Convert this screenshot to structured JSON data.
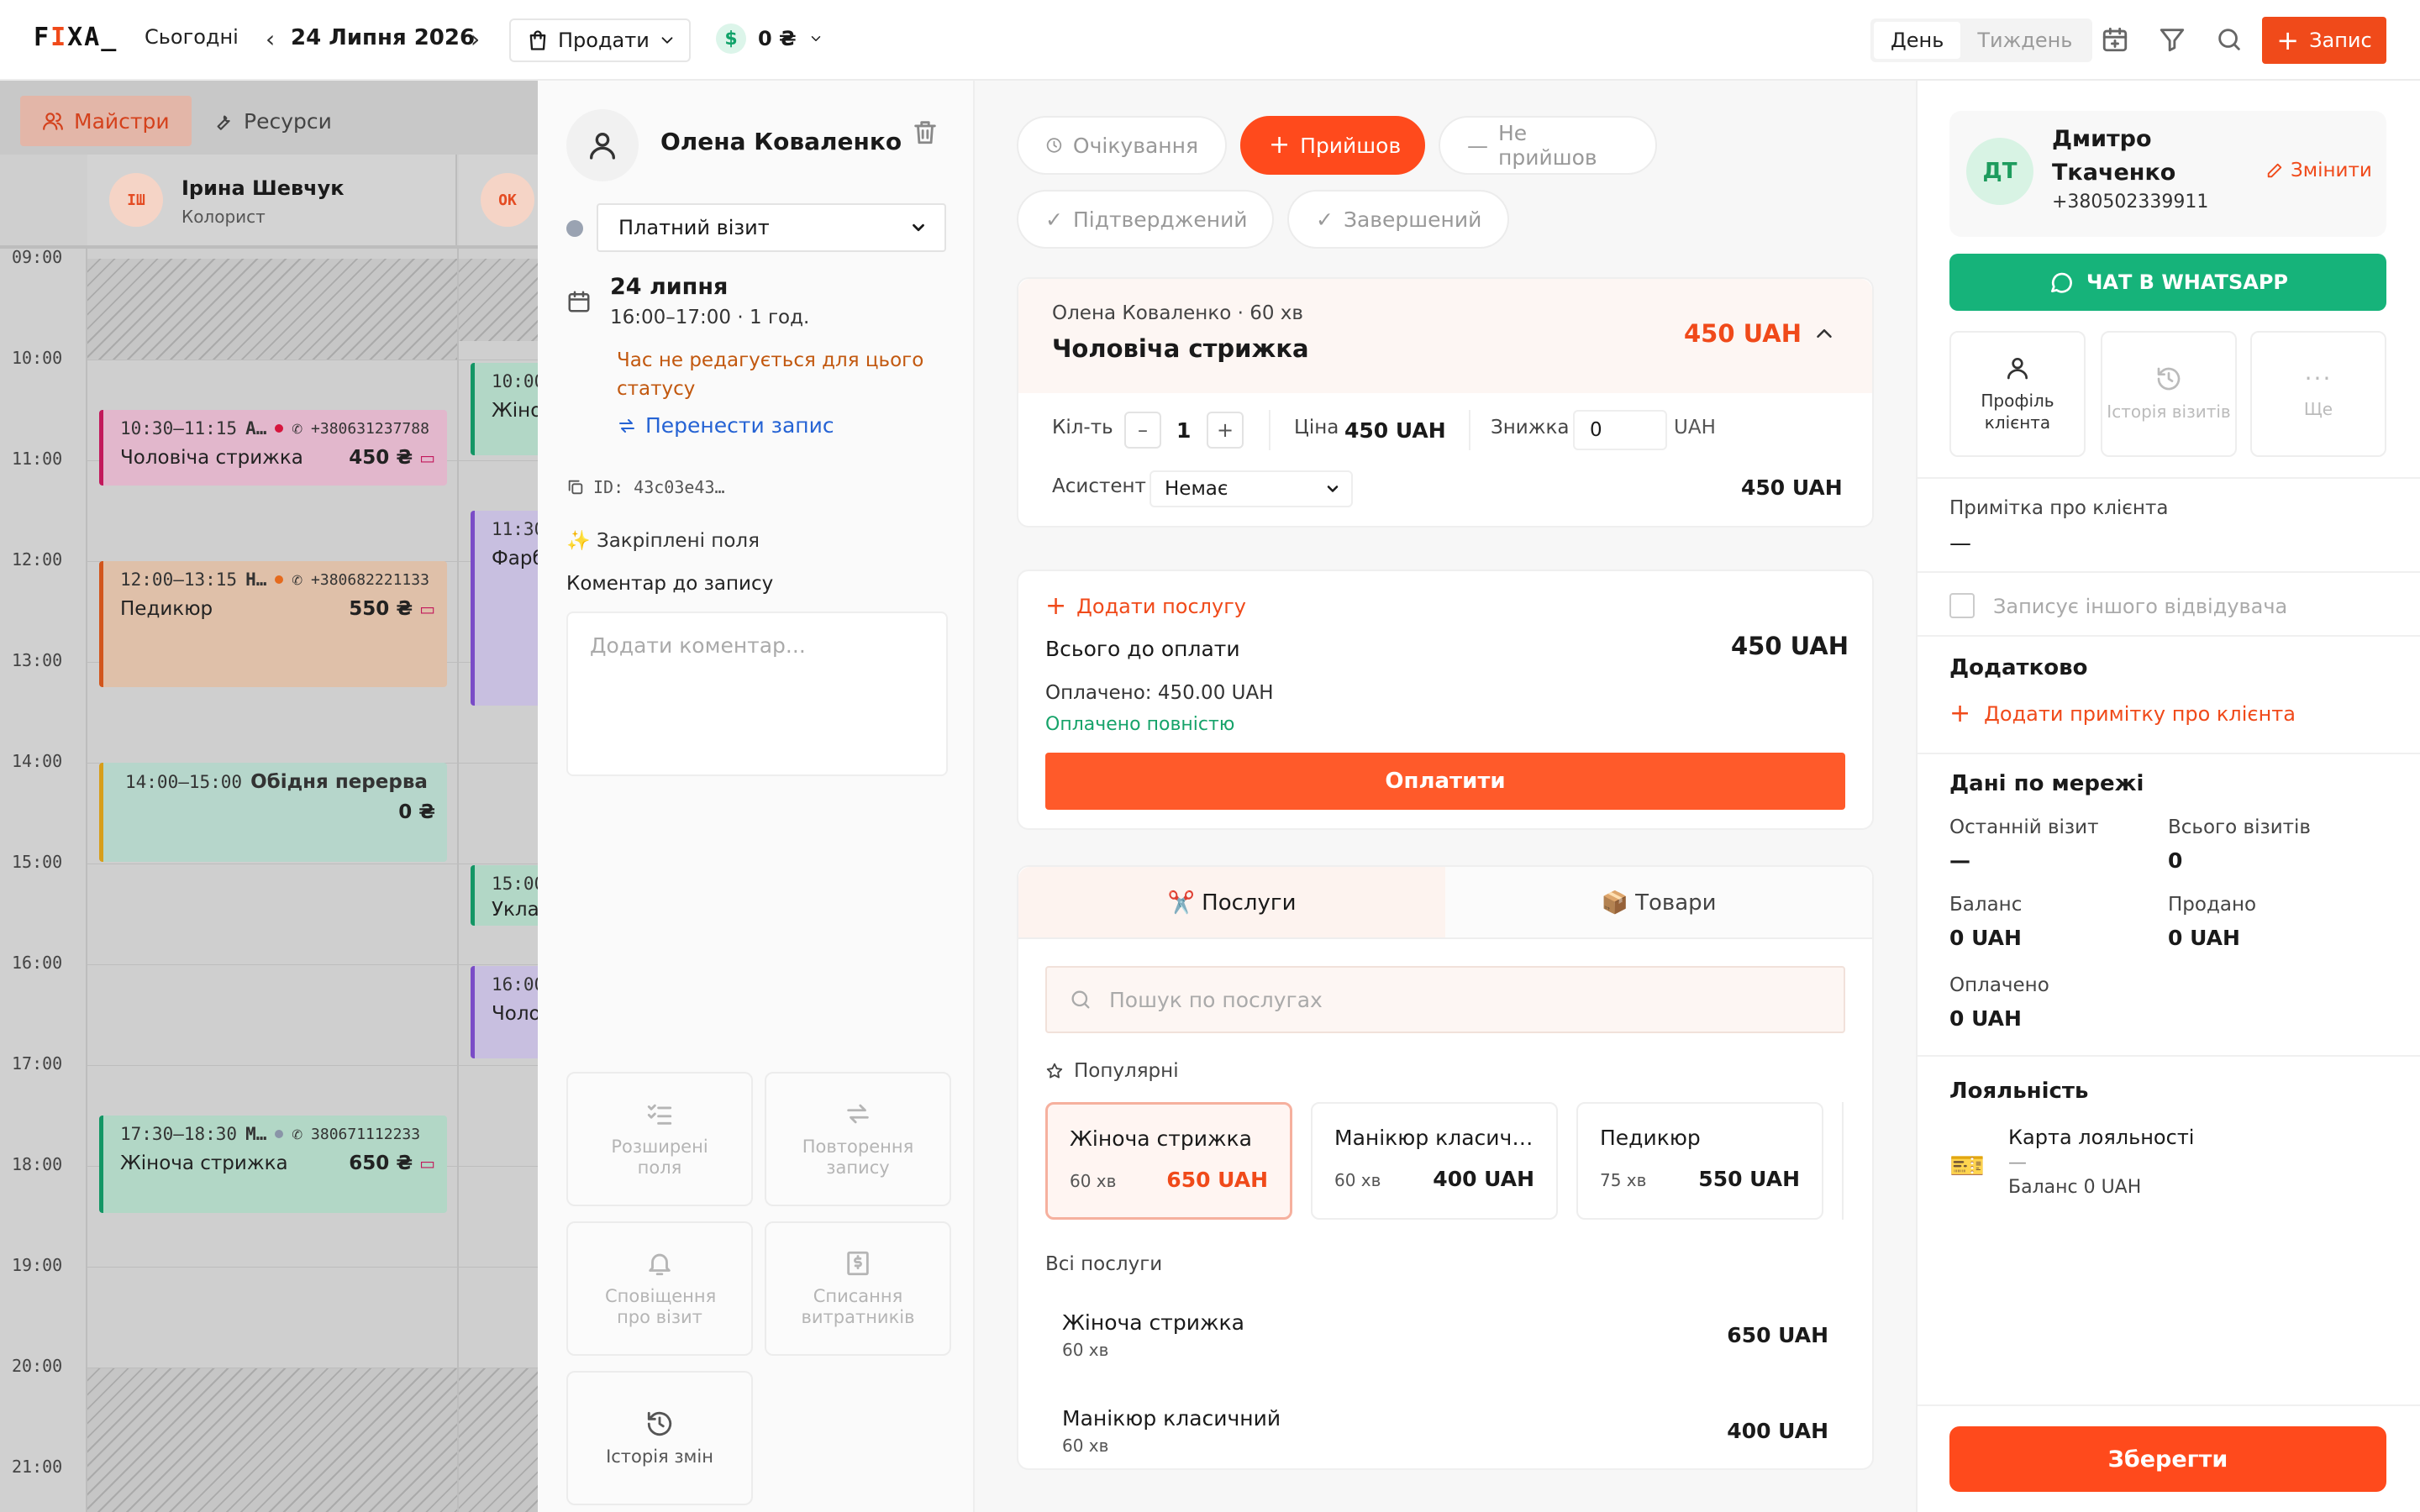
{
  "topbar": {
    "logo_a": "F",
    "logo_b": "I",
    "logo_c": "XA_",
    "today_label": "Сьогодні",
    "date_label": "24 Липня 2026",
    "prev_arrow": "‹",
    "next_arrow": "›",
    "sales_label": "Продати",
    "money_symbol": "$",
    "money_value": "0 ₴",
    "view_day": "День",
    "view_week": "Тиждень",
    "add_label": "Запис"
  },
  "calendar": {
    "tabs": {
      "masters": "Майстри",
      "resources": "Ресурси"
    },
    "masters": [
      {
        "initials": "ІШ",
        "name": "Ірина Шевчук",
        "role": "Колорист"
      },
      {
        "initials": "ОК",
        "name": "",
        "role": ""
      }
    ],
    "hours": [
      "09:00",
      "10:00",
      "11:00",
      "12:00",
      "13:00",
      "14:00",
      "15:00",
      "16:00",
      "17:00",
      "18:00",
      "19:00",
      "20:00",
      "21:00"
    ],
    "appointments": [
      {
        "time": "10:30–11:15",
        "client": "А…",
        "phone": "+380631237788",
        "service": "Чоловіча стрижка",
        "price": "450 ₴"
      },
      {
        "time": "12:00–13:15",
        "client": "Н…",
        "phone": "+380682221133",
        "service": "Педикюр",
        "price": "550 ₴"
      },
      {
        "time": "14:00–15:00",
        "client": "Обідня перерва",
        "phone": "",
        "service": "",
        "price": "0 ₴"
      },
      {
        "time": "17:30–18:30",
        "client": "М…",
        "phone": "380671112233",
        "service": "Жіноча стрижка",
        "price": "650 ₴"
      }
    ],
    "col2": [
      {
        "time": "10:00",
        "service": "Жіно"
      },
      {
        "time": "11:30",
        "service": "Фарб"
      },
      {
        "time": "15:00",
        "service": "Уклад"
      },
      {
        "time": "16:00",
        "service": "Чолов"
      }
    ]
  },
  "visit": {
    "client_name": "Олена Коваленко",
    "visit_type": "Платний візит",
    "date": "24 липня",
    "time_info": "16:00–17:00 · 1 год.",
    "warning": "Час не редагується для цього статусу",
    "reschedule": "Перенести запис",
    "id": "ID: 43c03e43…",
    "pinned": "Закріплені поля",
    "comment_label": "Коментар до запису",
    "comment_placeholder": "Додати коментар...",
    "quick": [
      {
        "label": "Розширені поля"
      },
      {
        "label": "Повторення запису"
      },
      {
        "label": "Сповіщення про візит"
      },
      {
        "label": "Списання витратників"
      },
      {
        "label": "Історія змін"
      }
    ]
  },
  "statuses": {
    "pending": "Очікування",
    "arrived": "Прийшов",
    "noshow": "Не прийшов",
    "confirmed": "Підтверджений",
    "completed": "Завершений"
  },
  "service_card": {
    "meta": "Олена Коваленко · 60 хв",
    "name": "Чоловіча стрижка",
    "price": "450 UAH",
    "qty_label": "Кіл-ть",
    "qty": "1",
    "price_label": "Ціна",
    "price_value": "450 UAH",
    "discount_label": "Знижка",
    "discount_value": "0",
    "discount_unit": "UAH",
    "assistant_label": "Асистент",
    "assistant_value": "Немає",
    "line_total": "450 UAH"
  },
  "payment": {
    "add_service": "Додати послугу",
    "total_label": "Всього до оплати",
    "total_value": "450 UAH",
    "paid": "Оплачено: 450.00 UAH",
    "paid_status": "Оплачено повністю",
    "pay_button": "Оплатити"
  },
  "catalog": {
    "tab_services": "✂️ Послуги",
    "tab_goods": "📦 Товари",
    "search_placeholder": "Пошук по послугах",
    "popular_label": "Популярні",
    "popular": [
      {
        "name": "Жіноча стрижка",
        "duration": "60 хв",
        "price": "650 UAH"
      },
      {
        "name": "Манікюр класичн…",
        "duration": "60 хв",
        "price": "400 UAH"
      },
      {
        "name": "Педикюр",
        "duration": "75 хв",
        "price": "550 UAH"
      }
    ],
    "all_label": "Всі послуги",
    "all": [
      {
        "name": "Жіноча стрижка",
        "duration": "60 хв",
        "price": "650 UAH"
      },
      {
        "name": "Манікюр класичний",
        "duration": "60 хв",
        "price": "400 UAH"
      }
    ]
  },
  "client_panel": {
    "initials": "ДТ",
    "name_line1": "Дмитро",
    "name_line2": "Ткаченко",
    "phone": "+380502339911",
    "edit": "Змінити",
    "whatsapp": "ЧАТ В WHATSAPP",
    "quick": [
      {
        "label": "Профіль клієнта"
      },
      {
        "label": "Історія візитів"
      },
      {
        "label": "Ще"
      }
    ],
    "note_label": "Примітка про клієнта",
    "note_value": "—",
    "other_visitor": "Записує іншого відвідувача",
    "extra_title": "Додатково",
    "add_note": "Додати примітку про клієнта",
    "network_title": "Дані по мережі",
    "last_visit_label": "Останній візит",
    "last_visit_value": "—",
    "total_visits_label": "Всього візитів",
    "total_visits_value": "0",
    "balance_label": "Баланс",
    "balance_value": "0 UAH",
    "sold_label": "Продано",
    "sold_value": "0 UAH",
    "paid_label": "Оплачено",
    "paid_value": "0 UAH",
    "loyalty_title": "Лояльність",
    "loyalty_card": "Карта лояльності",
    "loyalty_dash": "—",
    "loyalty_balance": "Баланс 0 UAH",
    "save": "Зберегти"
  },
  "colors": {
    "accent": "#ff4a1c",
    "whatsapp": "#16b37a",
    "link": "#2563d4",
    "warning": "#c2580f",
    "success": "#16a36a"
  }
}
